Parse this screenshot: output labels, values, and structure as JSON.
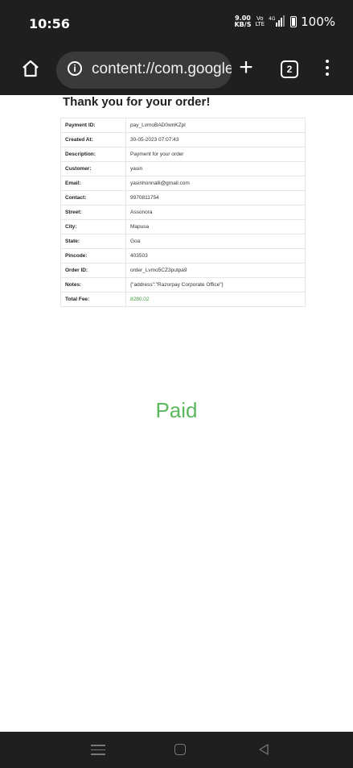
{
  "status_bar": {
    "time": "10:56",
    "net_speed_value": "9.00",
    "net_speed_unit": "KB/S",
    "volte_top": "Vo",
    "volte_bottom": "LTE",
    "signal": "₊4G⅂↓▎│",
    "battery": "100%"
  },
  "toolbar": {
    "url": "content://com.google.android",
    "tab_count": "2",
    "new_tab_symbol": "+"
  },
  "page": {
    "title": "Thank you for your order!",
    "paid_label": "Paid"
  },
  "order_details": [
    {
      "label": "Payment ID:",
      "value": "pay_LvmoBAD0wnKZpl"
    },
    {
      "label": "Created At:",
      "value": "30-05-2023 07:07:43"
    },
    {
      "label": "Description:",
      "value": "Payment for your order"
    },
    {
      "label": "Customer:",
      "value": "yasin"
    },
    {
      "label": "Email:",
      "value": "yasinhonnalli@gmail.com"
    },
    {
      "label": "Contact:",
      "value": "9970811754"
    },
    {
      "label": "Street:",
      "value": "Assonora"
    },
    {
      "label": "City:",
      "value": "Mapusa"
    },
    {
      "label": "State:",
      "value": "Goa"
    },
    {
      "label": "Pincode:",
      "value": "403503"
    },
    {
      "label": "Order ID:",
      "value": "order_Lvmo5CZ3putpa9"
    },
    {
      "label": "Notes:",
      "value": "{\"address\":\"Razorpay Corporate Office\"}"
    },
    {
      "label": "Total Fee:",
      "value": "8280.02"
    }
  ],
  "colors": {
    "paid": "#5cb85c",
    "fee": "#3c9a3c",
    "chrome_bg": "#1f1f1f"
  }
}
